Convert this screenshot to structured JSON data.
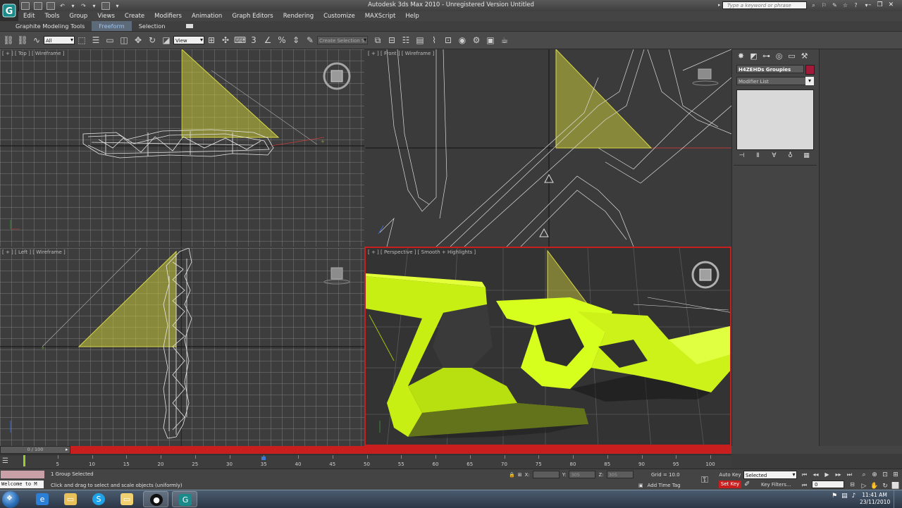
{
  "window": {
    "title": "Autodesk 3ds Max 2010  -  Unregistered Version   Untitled",
    "search_placeholder": "Type a keyword or phrase",
    "controls": [
      "–",
      "❐",
      "✕"
    ]
  },
  "menu": [
    "Edit",
    "Tools",
    "Group",
    "Views",
    "Create",
    "Modifiers",
    "Animation",
    "Graph Editors",
    "Rendering",
    "Customize",
    "MAXScript",
    "Help"
  ],
  "ribbon": {
    "tabs": [
      "Graphite Modeling Tools",
      "Freeform",
      "Selection"
    ],
    "active_tab": "Freeform"
  },
  "toolbar": {
    "filter_value": "All",
    "ref_coord_value": "View",
    "named_selection_placeholder": "Create Selection S"
  },
  "viewports": {
    "top": {
      "label": "[ + ] [ Top ] [ Wireframe ]"
    },
    "front": {
      "label": "[ + ] [ Front ] [ Wireframe ]"
    },
    "left": {
      "label": "[ + ] [ Left ] [ Wireframe ]"
    },
    "perspective": {
      "label": "[ + ] [ Perspective ] [ Smooth + Highlights ]"
    }
  },
  "command_panel": {
    "object_name": "H4ZEHDs Groupies",
    "object_color": "#a01a3a",
    "modifier_list": "Modifier List"
  },
  "timeline": {
    "frame_display": "0 / 100",
    "ticks": [
      0,
      5,
      10,
      15,
      20,
      25,
      30,
      35,
      40,
      45,
      50,
      55,
      60,
      65,
      70,
      75,
      80,
      85,
      90,
      95,
      100
    ],
    "tick_labels": [
      "5",
      "10",
      "15",
      "20",
      "25",
      "30",
      "35",
      "40",
      "45",
      "50",
      "55",
      "60",
      "65",
      "70",
      "75",
      "80",
      "85",
      "90",
      "95",
      "100"
    ],
    "current_frame": 35,
    "total_frames": 100
  },
  "status": {
    "maxscript_text": "Welcome to M",
    "selection_text": "1 Group Selected",
    "prompt_text": "Click and drag to select and scale objects (uniformly)",
    "x_label": "X:",
    "y_label": "Y:",
    "z_label": "Z:",
    "x_value": "",
    "y_value": "305",
    "z_value": "305",
    "grid_text": "Grid = 10.0",
    "add_time_tag": "Add Time Tag",
    "auto_key": "Auto Key",
    "set_key": "Set Key",
    "key_filters": "Key Filters...",
    "selected_dropdown": "Selected",
    "frame_value": "0"
  },
  "taskbar": {
    "clock_time": "11:41 AM",
    "clock_date": "23/11/2010"
  },
  "colors": {
    "accent_red": "#c91e1e",
    "object_yellow": "#d6ff1e",
    "helper_yellow": "#c8c84a"
  }
}
